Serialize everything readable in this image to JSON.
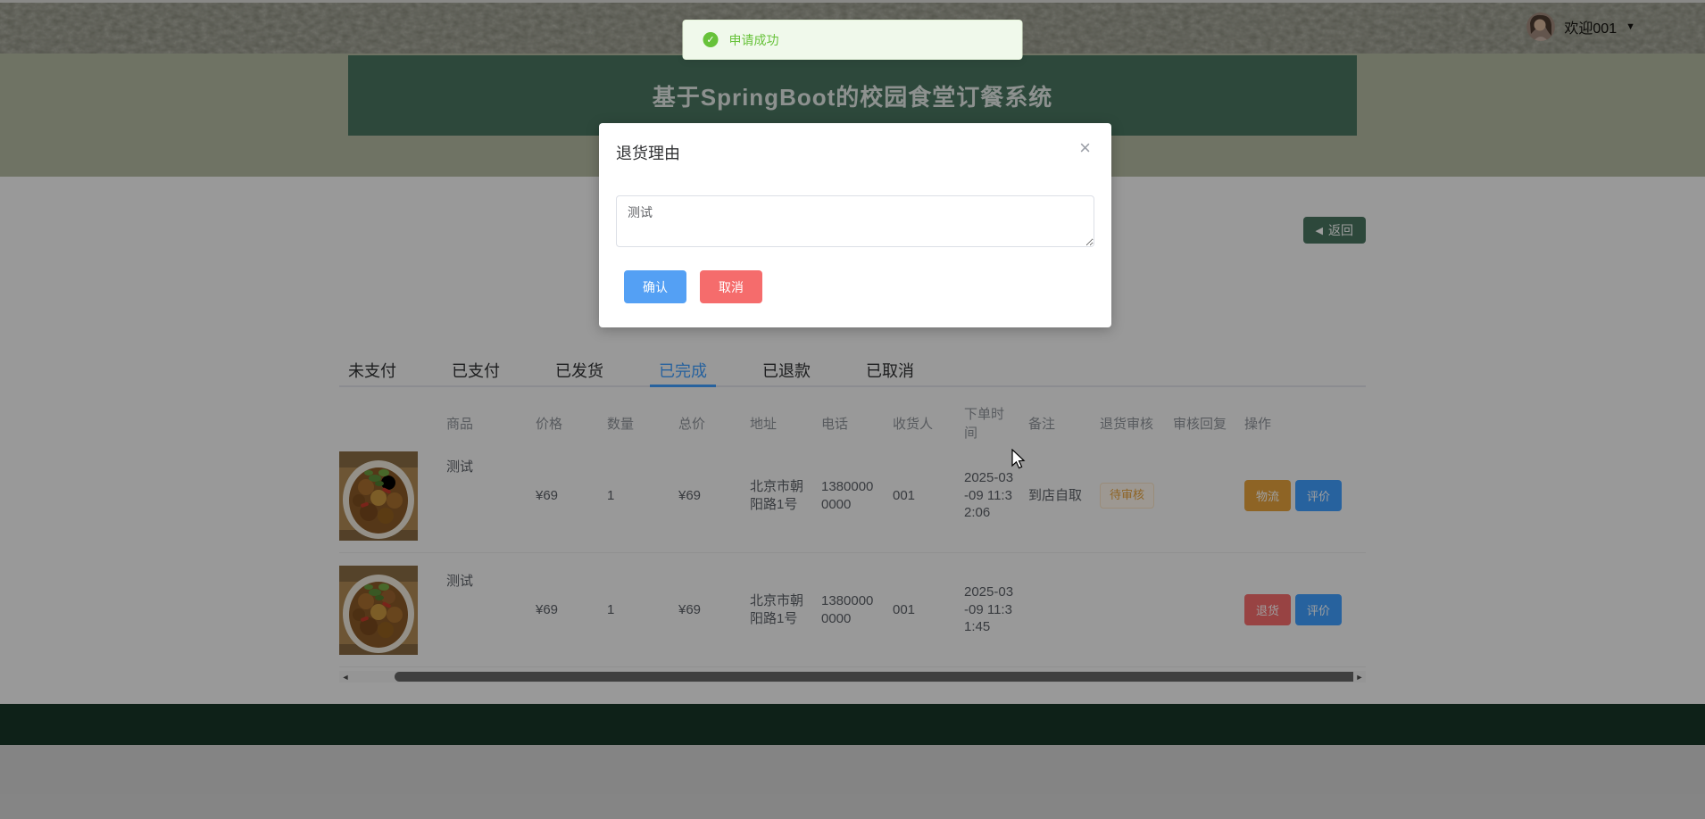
{
  "topbar": {
    "welcome": "欢迎001"
  },
  "toast": {
    "text": "申请成功"
  },
  "banner": {
    "title": "基于SpringBoot的校园食堂订餐系统"
  },
  "back": {
    "label": "返回"
  },
  "modal": {
    "title": "退货理由",
    "textarea_value": "测试",
    "confirm_label": "确认",
    "cancel_label": "取消"
  },
  "tabs": [
    {
      "label": "未支付",
      "active": false
    },
    {
      "label": "已支付",
      "active": false
    },
    {
      "label": "已发货",
      "active": false
    },
    {
      "label": "已完成",
      "active": true
    },
    {
      "label": "已退款",
      "active": false
    },
    {
      "label": "已取消",
      "active": false
    }
  ],
  "table": {
    "headers": [
      "商品",
      "价格",
      "数量",
      "总价",
      "地址",
      "电话",
      "收货人",
      "下单时间",
      "备注",
      "退货审核",
      "审核回复",
      "操作"
    ],
    "rows": [
      {
        "name": "测试",
        "price": "¥69",
        "qty": "1",
        "total": "¥69",
        "address": "北京市朝阳路1号",
        "phone": "13800000000",
        "receiver": "001",
        "time": "2025-03-09 11:32:06",
        "remark": "到店自取",
        "audit": "待审核",
        "reply": "",
        "actions": [
          {
            "label": "物流",
            "type": "warning"
          },
          {
            "label": "评价",
            "type": "primary"
          }
        ]
      },
      {
        "name": "测试",
        "price": "¥69",
        "qty": "1",
        "total": "¥69",
        "address": "北京市朝阳路1号",
        "phone": "13800000000",
        "receiver": "001",
        "time": "2025-03-09 11:31:45",
        "remark": "",
        "audit": "",
        "reply": "",
        "actions": [
          {
            "label": "退货",
            "type": "danger"
          },
          {
            "label": "评价",
            "type": "primary"
          }
        ]
      }
    ]
  },
  "icons": {
    "caret_down": "▼",
    "back_arrow": "◀",
    "close": "×",
    "check": "✓",
    "scroll_left": "◄",
    "scroll_right": "►"
  },
  "colors": {
    "primary_blue": "#409eff",
    "warning_orange": "#e6a23c",
    "danger_red": "#f56c6c",
    "success_green": "#67c23a",
    "banner_green": "#4a7560",
    "footer_green": "#173628",
    "confirm_blue": "#54a0f4"
  }
}
